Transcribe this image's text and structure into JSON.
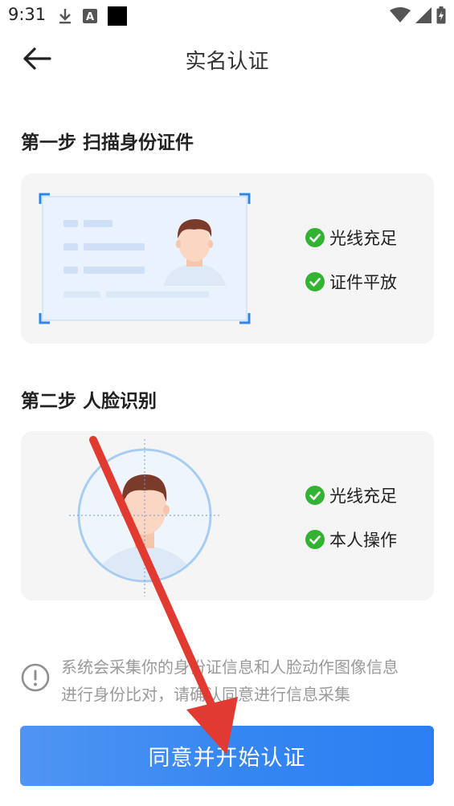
{
  "status_bar": {
    "time": "9:31",
    "left_icons": [
      "download-icon",
      "a-badge-icon",
      "black-square-icon"
    ],
    "right_icons": [
      "wifi-icon",
      "signal-icon",
      "battery-icon"
    ]
  },
  "header": {
    "title": "实名认证",
    "back_icon": "back-arrow-icon"
  },
  "step1": {
    "title": "第一步 扫描身份证件",
    "checks": [
      "光线充足",
      "证件平放"
    ]
  },
  "step2": {
    "title": "第二步 人脸识别",
    "checks": [
      "光线充足",
      "本人操作"
    ]
  },
  "notice": {
    "line1": "系统会采集你的身份证信息和人脸动作图像信息",
    "line2": "进行身份比对，请确认同意进行信息采集",
    "icon": "info-icon"
  },
  "primary_button": {
    "label": "同意并开始认证"
  },
  "colors": {
    "accent": "#3586f2",
    "check_green": "#33b332",
    "card_bg": "#f5f5f6",
    "annotation_arrow": "#e03a31"
  }
}
